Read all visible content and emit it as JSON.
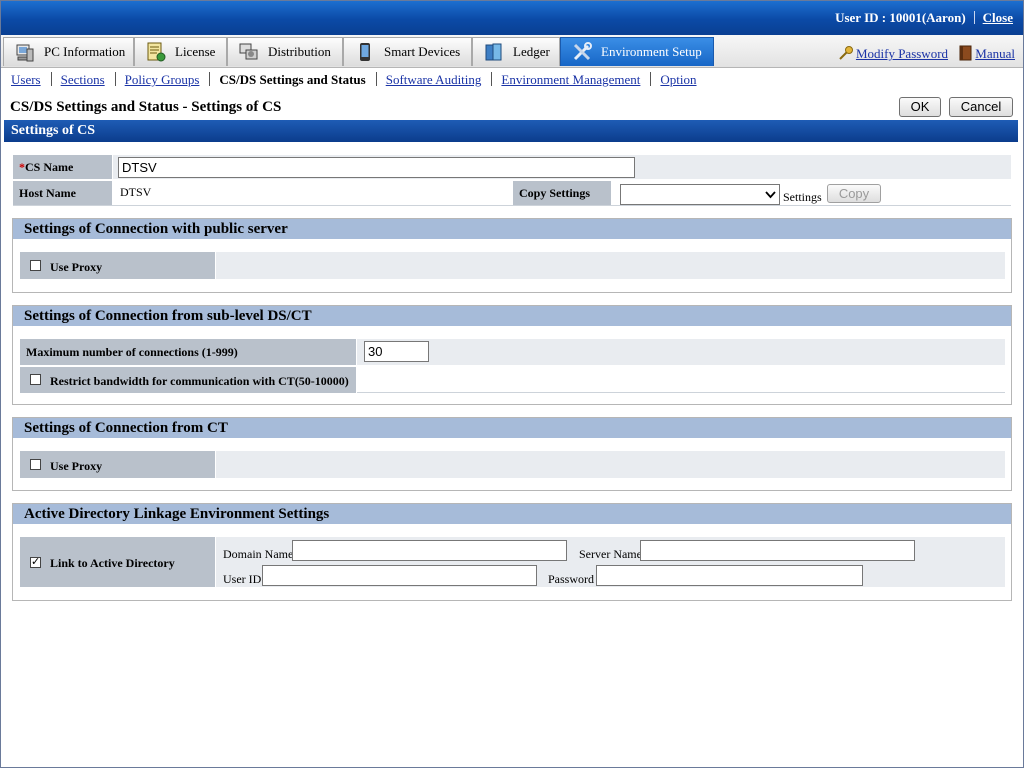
{
  "header": {
    "user_id": "User ID : 10001(Aaron)",
    "close": "Close"
  },
  "tabs": [
    {
      "label": "PC Information",
      "icon": "pc-icon"
    },
    {
      "label": "License",
      "icon": "license-icon"
    },
    {
      "label": "Distribution",
      "icon": "distribution-icon"
    },
    {
      "label": "Smart Devices",
      "icon": "smart-device-icon"
    },
    {
      "label": "Ledger",
      "icon": "ledger-icon"
    },
    {
      "label": "Environment Setup",
      "icon": "tools-icon",
      "active": true
    }
  ],
  "top_links": {
    "modify_password": "Modify Password",
    "manual": "Manual"
  },
  "submenu": [
    "Users",
    "Sections",
    "Policy Groups",
    "CS/DS Settings and Status",
    "Software Auditing",
    "Environment Management",
    "Option"
  ],
  "page": {
    "title": "CS/DS Settings and Status - Settings of CS",
    "ok": "OK",
    "cancel": "Cancel",
    "section_title": "Settings of CS"
  },
  "cs": {
    "required_mark": "*",
    "name_label": "CS Name",
    "name_value": "DTSV",
    "host_label": "Host Name",
    "host_value": "DTSV",
    "copy_label": "Copy Settings",
    "copy_select_value": "",
    "settings_label": "Settings",
    "copy_button": "Copy"
  },
  "public_server": {
    "title": "Settings of Connection with public server",
    "use_proxy": "Use Proxy",
    "use_proxy_checked": false
  },
  "sub_level": {
    "title": "Settings of Connection from sub-level DS/CT",
    "max_conn_label": "Maximum number of connections (1-999)",
    "max_conn_value": "30",
    "restrict_label": "Restrict bandwidth for communication with CT(50-10000)",
    "restrict_checked": false
  },
  "from_ct": {
    "title": "Settings of Connection from CT",
    "use_proxy": "Use Proxy",
    "use_proxy_checked": false
  },
  "active_directory": {
    "title": "Active Directory Linkage Environment Settings",
    "link_label": "Link to Active Directory",
    "link_checked": true,
    "domain_label": "Domain Name",
    "domain_value": "",
    "server_label": "Server Name",
    "server_value": "",
    "userid_label": "User ID",
    "userid_value": "",
    "password_label": "Password",
    "password_value": ""
  },
  "colors": {
    "header_blue": "#0b4aa6",
    "section_blue": "#1e5cb5",
    "group_header": "#a6bbd9",
    "label_gray": "#b9c1cb",
    "link": "#1a33a6"
  }
}
